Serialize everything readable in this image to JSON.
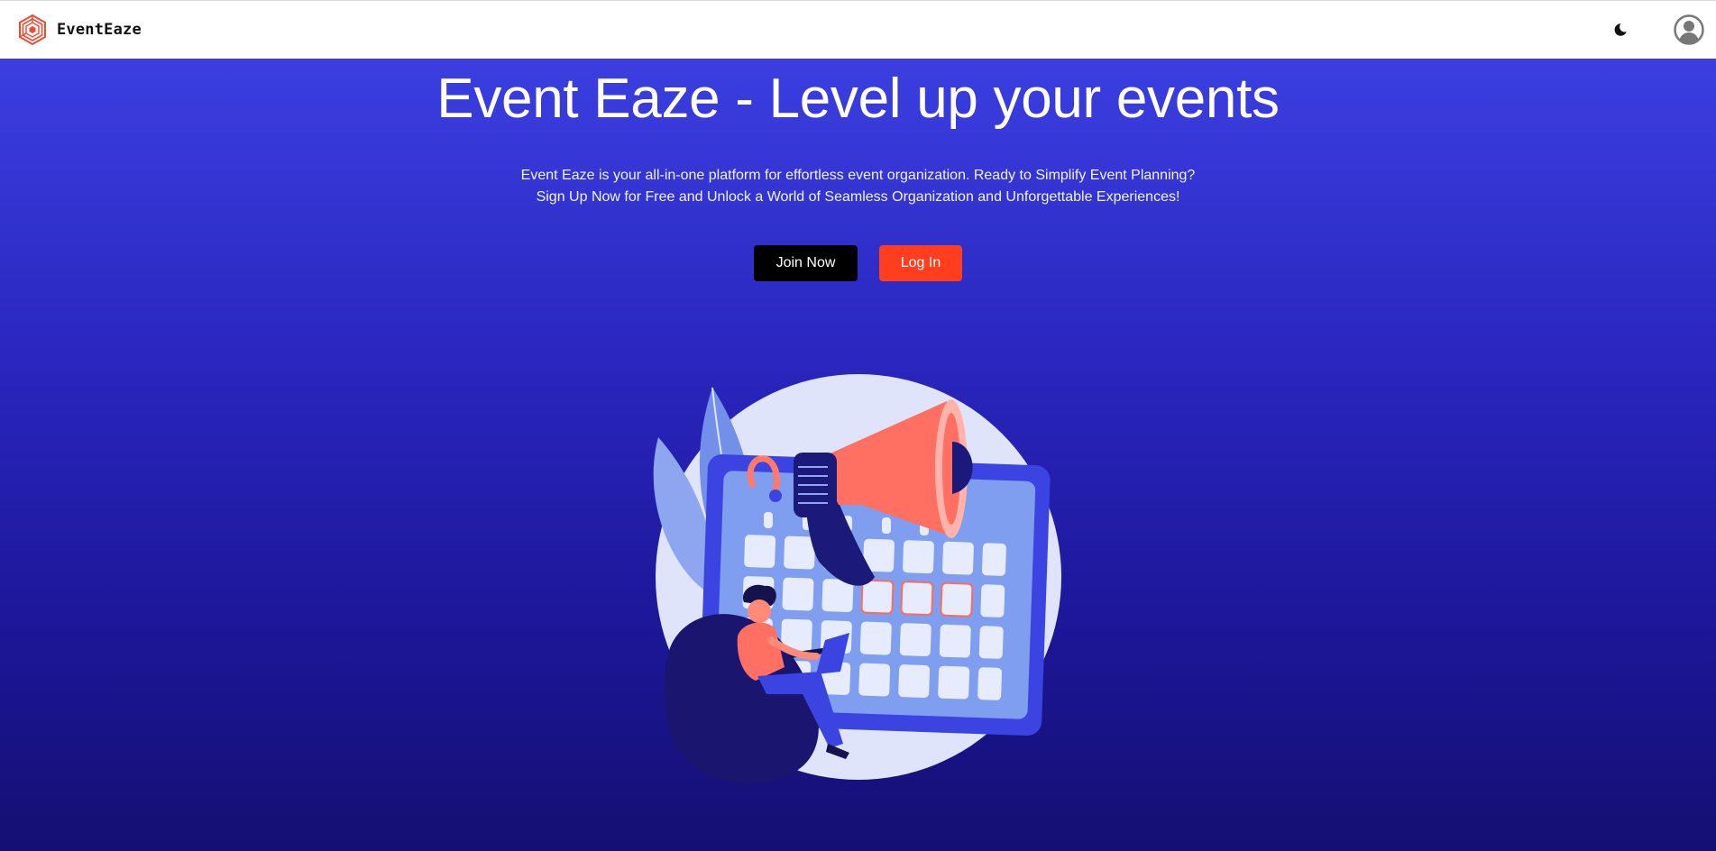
{
  "header": {
    "brand_name": "EventEaze",
    "logo_icon": "hexagon-cube-logo",
    "theme_toggle_icon": "moon-icon",
    "profile_icon": "user-avatar-icon"
  },
  "hero": {
    "title": "Event Eaze - Level up your events",
    "subtitle_line1": "Event Eaze is your all-in-one platform for effortless event organization. Ready to Simplify Event Planning?",
    "subtitle_line2": "Sign Up Now for Free and Unlock a World of Seamless Organization and Unforgettable Experiences!",
    "join_label": "Join Now",
    "login_label": "Log In",
    "illustration_icon": "calendar-megaphone-illustration"
  },
  "colors": {
    "accent": "#ff3d1f",
    "hero_top": "#3b3fe0",
    "hero_bottom": "#140f72",
    "join_button": "#000000"
  }
}
